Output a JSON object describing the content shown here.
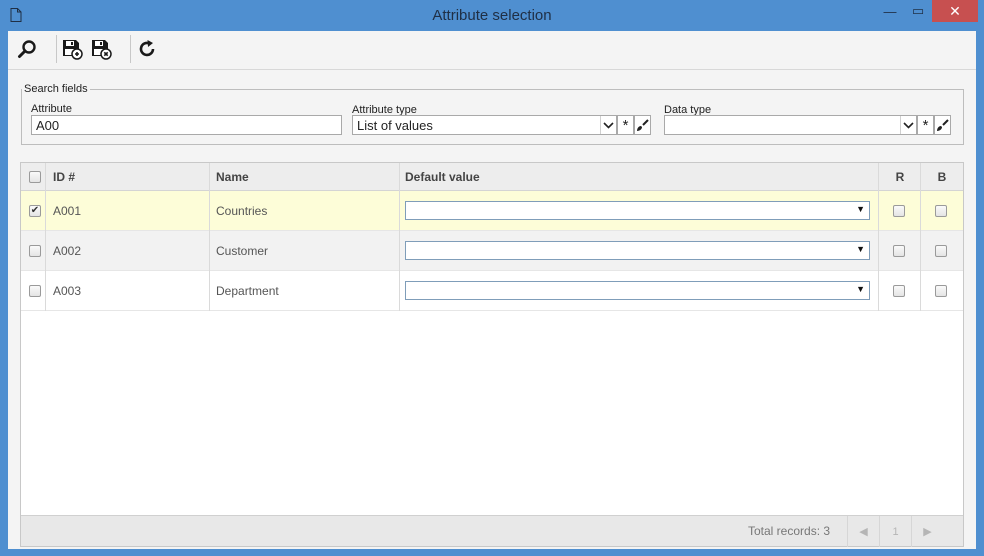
{
  "window": {
    "title": "Attribute selection",
    "minimize_glyph": "—",
    "maximize_glyph": "▭",
    "close_glyph": "✕"
  },
  "toolbar": {
    "icons": [
      "search-icon",
      "save-new-icon",
      "save-close-icon",
      "refresh-icon"
    ]
  },
  "search": {
    "legend": "Search fields",
    "attribute_label": "Attribute",
    "attribute_value": "A00",
    "attribute_type_label": "Attribute type",
    "attribute_type_value": "List of values",
    "data_type_label": "Data type",
    "data_type_value": "",
    "asterisk": "*"
  },
  "grid": {
    "columns": [
      "ID #",
      "Name",
      "Default value",
      "R",
      "B"
    ],
    "rows": [
      {
        "id": "A001",
        "name": "Countries",
        "default_value": "",
        "checked": true,
        "r": false,
        "b": false
      },
      {
        "id": "A002",
        "name": "Customer",
        "default_value": "",
        "checked": false,
        "r": false,
        "b": false
      },
      {
        "id": "A003",
        "name": "Department",
        "default_value": "",
        "checked": false,
        "r": false,
        "b": false
      }
    ],
    "check_glyph": "✔"
  },
  "footer": {
    "total_records": "Total records: 3",
    "prev_glyph": "◀",
    "page": "1",
    "next_glyph": "▶"
  },
  "colors": {
    "frame": "#4f8fd0",
    "close": "#c75050",
    "selected_row": "#fdfdd8"
  }
}
